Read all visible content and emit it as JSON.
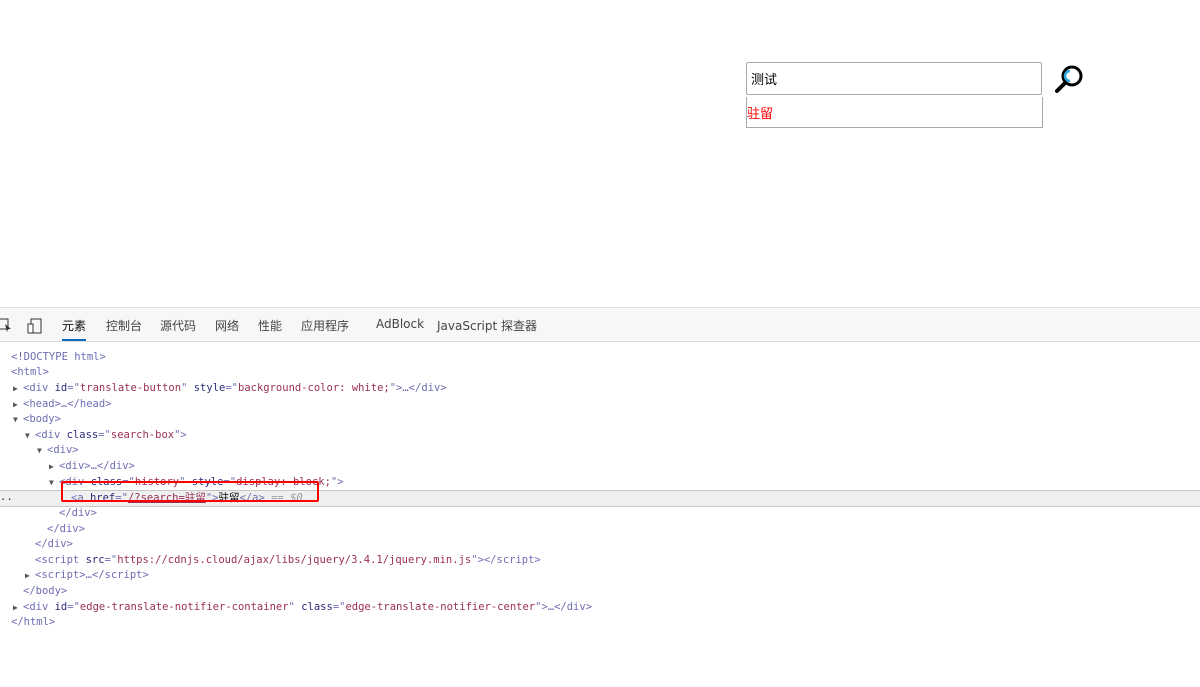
{
  "search": {
    "value": "测试",
    "history_item": "驻留",
    "icon": "magnifier-icon"
  },
  "devtools": {
    "tabs": [
      "元素",
      "控制台",
      "源代码",
      "网络",
      "性能",
      "应用程序",
      "AdBlock",
      "JavaScript 探查器"
    ],
    "active_tab": "元素",
    "ellipsis": "..",
    "lines": [
      {
        "indent": 0,
        "tri": "",
        "parts": [
          [
            "tag",
            "<!DOCTYPE html>"
          ]
        ]
      },
      {
        "indent": 0,
        "tri": "",
        "parts": [
          [
            "tag",
            "<html>"
          ]
        ]
      },
      {
        "indent": 1,
        "tri": "▶",
        "parts": [
          [
            "tag",
            "<div "
          ],
          [
            "an",
            "id"
          ],
          [
            "tag",
            "=\""
          ],
          [
            "av",
            "translate-button"
          ],
          [
            "tag",
            "\" "
          ],
          [
            "an",
            "style"
          ],
          [
            "tag",
            "=\""
          ],
          [
            "av",
            "background-color: white;"
          ],
          [
            "tag",
            "\">…</div>"
          ]
        ]
      },
      {
        "indent": 1,
        "tri": "▶",
        "parts": [
          [
            "tag",
            "<head>…</head>"
          ]
        ]
      },
      {
        "indent": 1,
        "tri": "▼",
        "parts": [
          [
            "tag",
            "<body>"
          ]
        ]
      },
      {
        "indent": 2,
        "tri": "▼",
        "parts": [
          [
            "tag",
            "<div "
          ],
          [
            "an",
            "class"
          ],
          [
            "tag",
            "=\""
          ],
          [
            "av",
            "search-box"
          ],
          [
            "tag",
            "\">"
          ]
        ]
      },
      {
        "indent": 3,
        "tri": "▼",
        "parts": [
          [
            "tag",
            "<div>"
          ]
        ]
      },
      {
        "indent": 4,
        "tri": "▶",
        "parts": [
          [
            "tag",
            "<div>…</div>"
          ]
        ]
      },
      {
        "indent": 4,
        "tri": "▼",
        "parts": [
          [
            "tag",
            "<div "
          ],
          [
            "an",
            "class"
          ],
          [
            "tag",
            "=\""
          ],
          [
            "av",
            "history"
          ],
          [
            "tag",
            "\" "
          ],
          [
            "an",
            "style"
          ],
          [
            "tag",
            "=\""
          ],
          [
            "av",
            "display: block;"
          ],
          [
            "tag",
            "\">"
          ]
        ]
      },
      {
        "indent": 5,
        "tri": "",
        "selected": true,
        "parts": [
          [
            "tag",
            "<a "
          ],
          [
            "an",
            "href"
          ],
          [
            "tag",
            "=\""
          ],
          [
            "link",
            "/?search=驻留"
          ],
          [
            "tag",
            "\">"
          ],
          [
            "tx",
            "驻留"
          ],
          [
            "tag",
            "</a>"
          ],
          [
            "dim",
            " == $0"
          ]
        ]
      },
      {
        "indent": 4,
        "tri": "",
        "parts": [
          [
            "tag",
            "</div>"
          ]
        ]
      },
      {
        "indent": 3,
        "tri": "",
        "parts": [
          [
            "tag",
            "</div>"
          ]
        ]
      },
      {
        "indent": 2,
        "tri": "",
        "parts": [
          [
            "tag",
            "</div>"
          ]
        ]
      },
      {
        "indent": 2,
        "tri": "",
        "parts": [
          [
            "tag",
            "<script "
          ],
          [
            "an",
            "src"
          ],
          [
            "tag",
            "=\""
          ],
          [
            "av",
            "https://cdnjs.cloud/ajax/libs/jquery/3.4.1/jquery.min.js"
          ],
          [
            "tag",
            "\"></script>"
          ]
        ]
      },
      {
        "indent": 2,
        "tri": "▶",
        "parts": [
          [
            "tag",
            "<script>…</script>"
          ]
        ]
      },
      {
        "indent": 1,
        "tri": "",
        "parts": [
          [
            "tag",
            "</body>"
          ]
        ]
      },
      {
        "indent": 1,
        "tri": "▶",
        "parts": [
          [
            "tag",
            "<div "
          ],
          [
            "an",
            "id"
          ],
          [
            "tag",
            "=\""
          ],
          [
            "av",
            "edge-translate-notifier-container"
          ],
          [
            "tag",
            "\" "
          ],
          [
            "an",
            "class"
          ],
          [
            "tag",
            "=\""
          ],
          [
            "av",
            "edge-translate-notifier-center"
          ],
          [
            "tag",
            "\">…</div>"
          ]
        ]
      },
      {
        "indent": 0,
        "tri": "",
        "parts": [
          [
            "tag",
            "</html>"
          ]
        ]
      }
    ]
  }
}
